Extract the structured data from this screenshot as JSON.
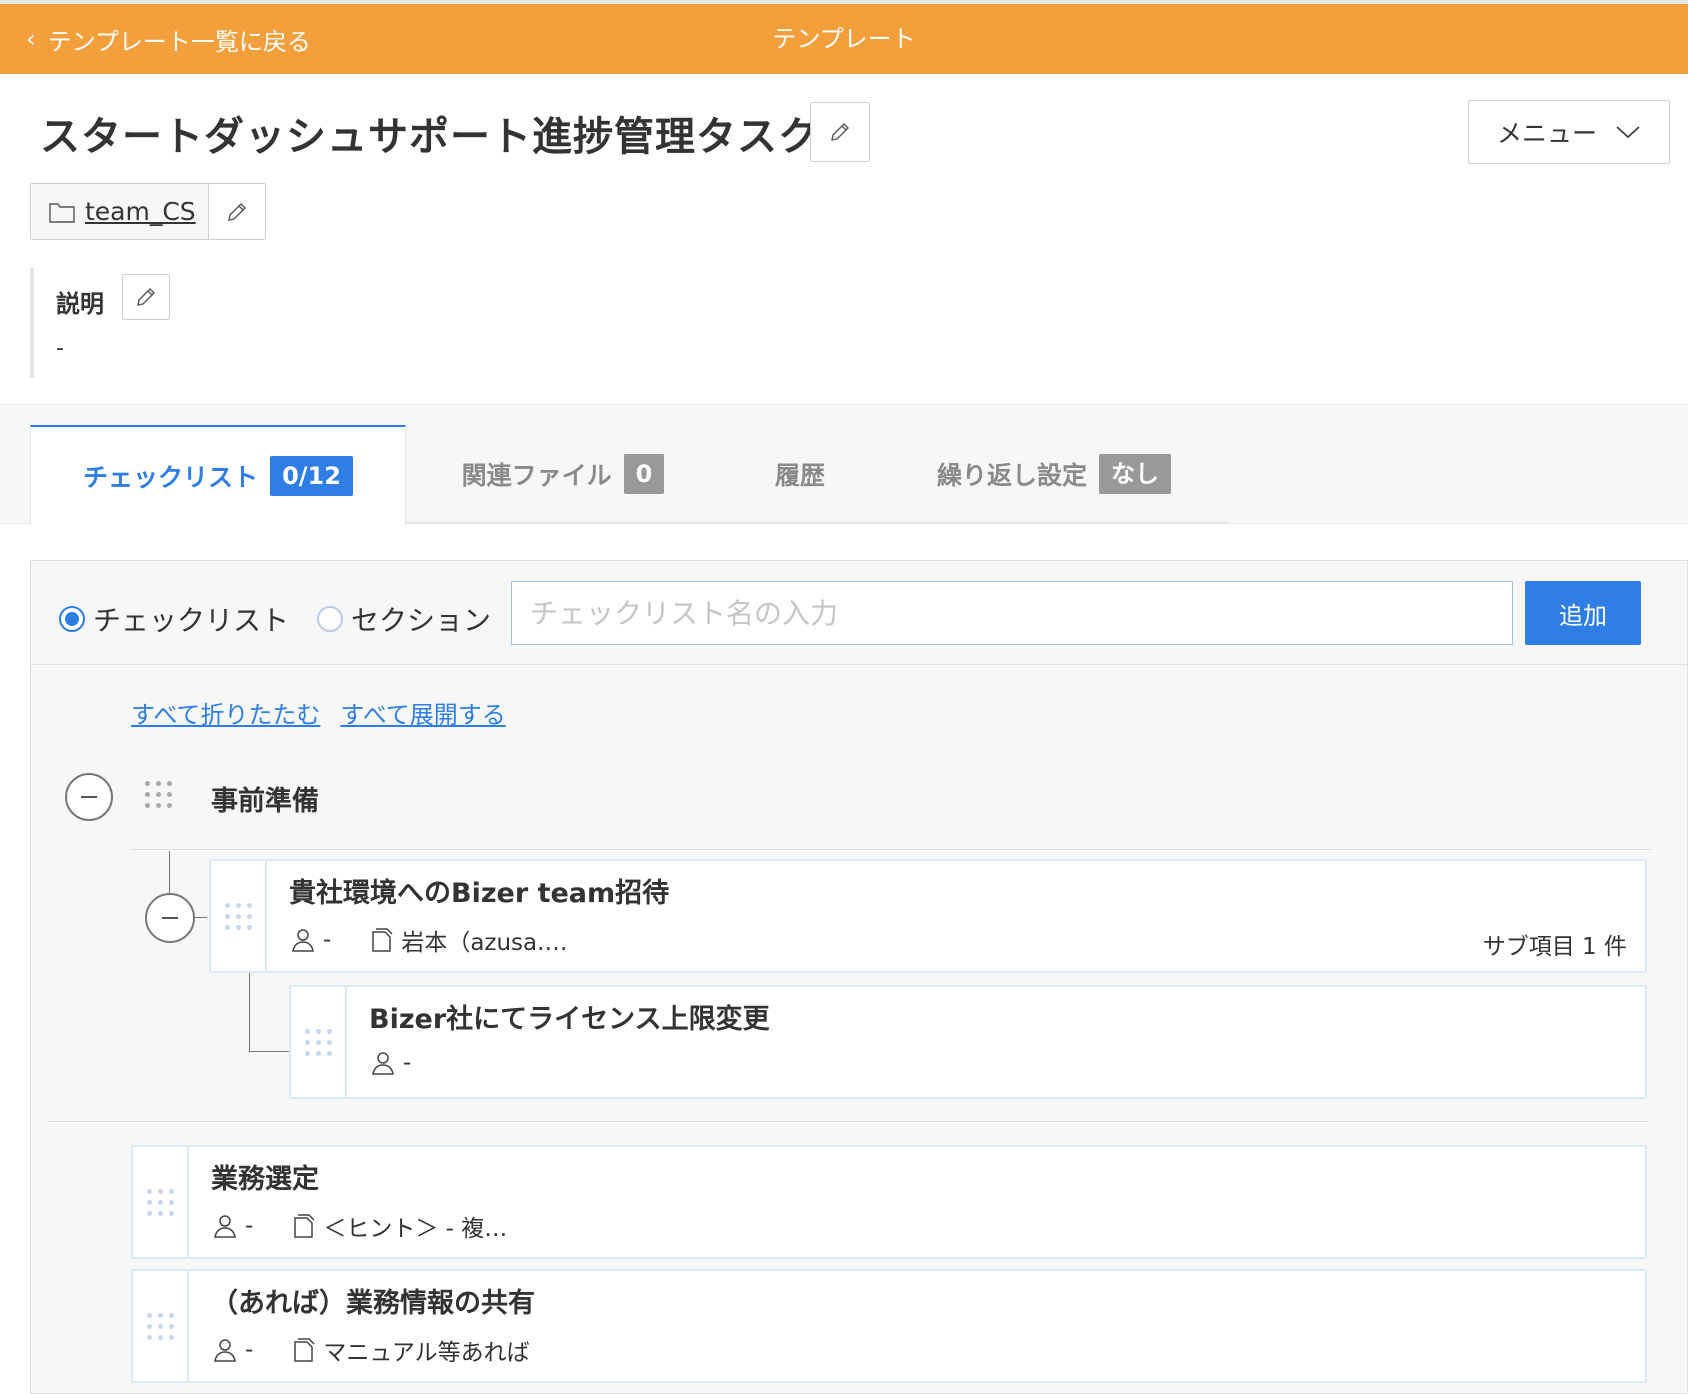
{
  "topbar": {
    "back_label": "テンプレート一覧に戻る",
    "title": "テンプレート"
  },
  "page": {
    "title": "スタートダッシュサポート進捗管理タスク",
    "menu_label": "メニュー"
  },
  "folder": {
    "name": "team_CS"
  },
  "description": {
    "label": "説明",
    "value": "-"
  },
  "tabs": [
    {
      "label": "チェックリスト",
      "badge": "0/12"
    },
    {
      "label": "関連ファイル",
      "badge": "0"
    },
    {
      "label": "履歴",
      "badge": ""
    },
    {
      "label": "繰り返し設定",
      "badge": "なし"
    }
  ],
  "add_bar": {
    "radio_checklist": "チェックリスト",
    "radio_section": "セクション",
    "input_placeholder": "チェックリスト名の入力",
    "add_label": "追加"
  },
  "links": {
    "collapse_all": "すべて折りたたむ",
    "expand_all": "すべて展開する"
  },
  "section": {
    "title": "事前準備"
  },
  "items": [
    {
      "title": "貴社環境へのBizer team招待",
      "assignee": "-",
      "memo": "岩本（azusa.…",
      "sub": "サブ項目 1 件"
    },
    {
      "title": "Bizer社にてライセンス上限変更",
      "assignee": "-"
    },
    {
      "title": "業務選定",
      "assignee": "-",
      "memo": "＜ヒント＞ - 複…"
    },
    {
      "title": "（あれば）業務情報の共有",
      "assignee": "-",
      "memo": "マニュアル等あれば"
    }
  ]
}
